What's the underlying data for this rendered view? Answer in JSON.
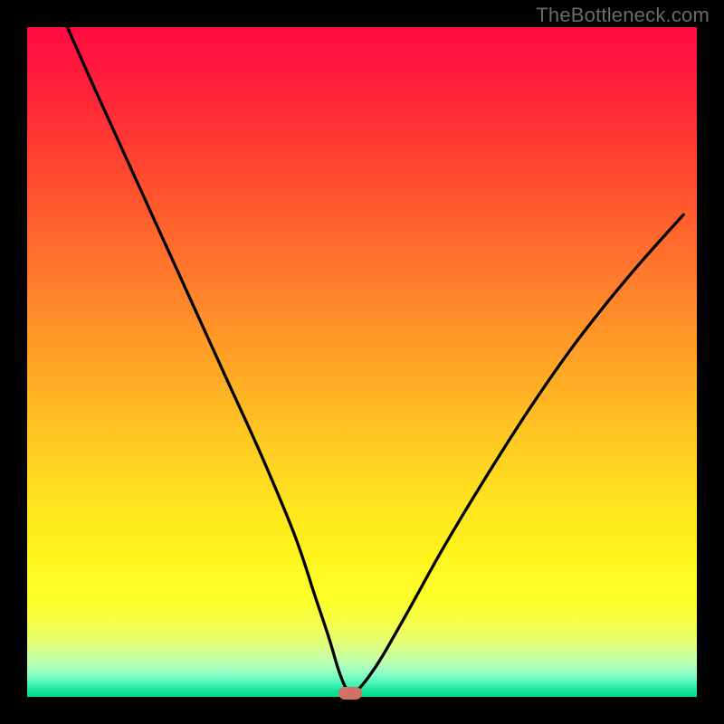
{
  "watermark": "TheBottleneck.com",
  "chart_data": {
    "type": "line",
    "title": "",
    "xlabel": "",
    "ylabel": "",
    "xlim": [
      0,
      100
    ],
    "ylim": [
      0,
      100
    ],
    "series": [
      {
        "name": "bottleneck-curve",
        "x": [
          6,
          10,
          15,
          20,
          25,
          30,
          35,
          40,
          43,
          45,
          46.5,
          47.5,
          48.3,
          49.5,
          51,
          53,
          57,
          62,
          68,
          75,
          82,
          90,
          98
        ],
        "values": [
          100,
          91,
          80,
          69,
          58,
          47,
          36,
          24,
          15,
          9,
          4,
          1.5,
          0.6,
          1.2,
          3,
          6,
          13,
          22,
          32,
          43,
          53,
          63,
          72
        ]
      }
    ],
    "marker": {
      "x": 48.3,
      "y": 0.6
    },
    "background_gradient": {
      "top": "#ff0b42",
      "mid": "#fff31d",
      "bottom": "#00d988"
    }
  }
}
